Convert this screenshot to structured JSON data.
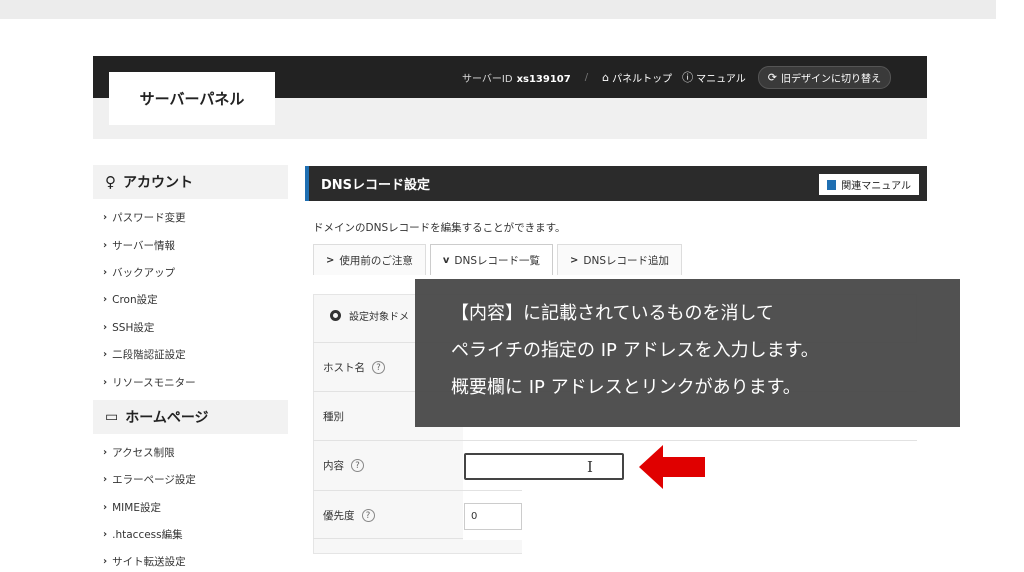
{
  "header": {
    "logo": "サーバーパネル",
    "server_id_label": "サーバーID",
    "server_id": "xs139107",
    "panel_top": "パネルトップ",
    "manual": "マニュアル",
    "switch_design": "旧デザインに切り替え"
  },
  "sidebar": {
    "account_heading": "アカウント",
    "account_items": [
      "パスワード変更",
      "サーバー情報",
      "バックアップ",
      "Cron設定",
      "SSH設定",
      "二段階認証設定",
      "リソースモニター"
    ],
    "homepage_heading": "ホームページ",
    "homepage_items": [
      "アクセス制限",
      "エラーページ設定",
      "MIME設定",
      ".htaccess編集",
      "サイト転送設定"
    ]
  },
  "main": {
    "title": "DNSレコード設定",
    "manual_button": "関連マニュアル",
    "description": "ドメインのDNSレコードを編集することができます。",
    "tabs": [
      {
        "label": "使用前のご注意",
        "chevron": ">"
      },
      {
        "label": "DNSレコード一覧",
        "chevron": "v"
      },
      {
        "label": "DNSレコード追加",
        "chevron": ">"
      }
    ],
    "target_label": "設定対象ドメ",
    "form": {
      "host_label": "ホスト名",
      "type_label": "種別",
      "content_label": "内容",
      "priority_label": "優先度",
      "priority_value": "0"
    }
  },
  "overlay": {
    "lines": [
      "【内容】に記載されているものを消して",
      "ペライチの指定の IP アドレスを入力します。",
      "概要欄に IP アドレスとリンクがあります。"
    ]
  },
  "colors": {
    "header_bg": "#222222",
    "accent_blue": "#1f6fb2",
    "arrow_red": "#e00000",
    "overlay_bg": "#464646"
  }
}
